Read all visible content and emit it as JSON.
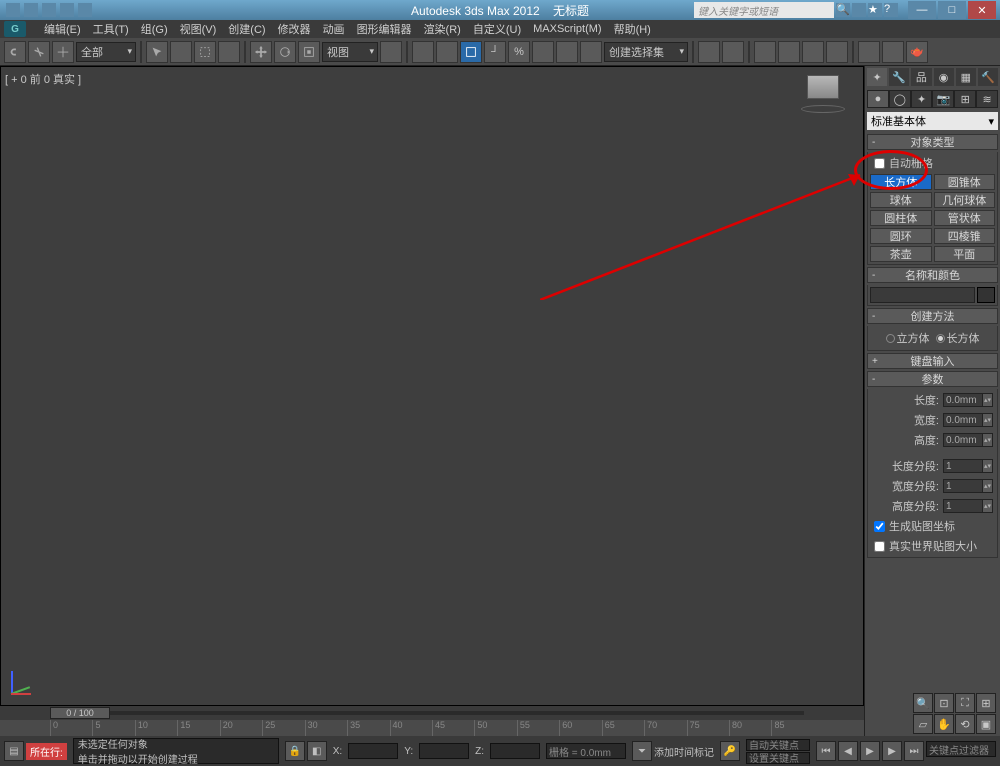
{
  "title": {
    "app": "Autodesk 3ds Max  2012",
    "doc": "无标题"
  },
  "search": {
    "placeholder": "键入关键字或短语"
  },
  "menu": [
    "编辑(E)",
    "工具(T)",
    "组(G)",
    "视图(V)",
    "创建(C)",
    "修改器",
    "动画",
    "图形编辑器",
    "渲染(R)",
    "自定义(U)",
    "MAXScript(M)",
    "帮助(H)"
  ],
  "toolbar": {
    "scope": "全部",
    "viewlabel": "视图",
    "create_sel": "创建选择集"
  },
  "viewport": {
    "label": "[ + 0 前 0 真实 ]"
  },
  "panel": {
    "primitive_dd": "标准基本体",
    "object_type_title": "对象类型",
    "auto_grid": "自动栅格",
    "objects": [
      [
        "长方体",
        "圆锥体"
      ],
      [
        "球体",
        "几何球体"
      ],
      [
        "圆柱体",
        "管状体"
      ],
      [
        "圆环",
        "四棱锥"
      ],
      [
        "茶壶",
        "平面"
      ]
    ],
    "name_color_title": "名称和颜色",
    "create_method_title": "创建方法",
    "method_cube": "立方体",
    "method_box": "长方体",
    "keyboard_entry_title": "键盘输入",
    "params_title": "参数",
    "length_lbl": "长度:",
    "length_val": "0.0mm",
    "width_lbl": "宽度:",
    "width_val": "0.0mm",
    "height_lbl": "高度:",
    "height_val": "0.0mm",
    "lseg_lbl": "长度分段:",
    "lseg_val": "1",
    "wseg_lbl": "宽度分段:",
    "wseg_val": "1",
    "hseg_lbl": "高度分段:",
    "hseg_val": "1",
    "gen_map": "生成贴图坐标",
    "real_world": "真实世界贴图大小"
  },
  "timeline": {
    "handle": "0 / 100",
    "ticks": [
      "0",
      "5",
      "10",
      "15",
      "20",
      "25",
      "30",
      "35",
      "40",
      "45",
      "50",
      "55",
      "60",
      "65",
      "70",
      "75",
      "80",
      "85"
    ]
  },
  "status": {
    "nowline": "所在行:",
    "msg1": "未选定任何对象",
    "msg2": "单击并拖动以开始创建过程",
    "addtime": "添加时间标记",
    "x": "X:",
    "y": "Y:",
    "z": "Z:",
    "grid": "栅格 = 0.0mm",
    "autokey": "自动关键点",
    "setkey": "设置关键点",
    "keyfilter": "关键点过滤器"
  }
}
